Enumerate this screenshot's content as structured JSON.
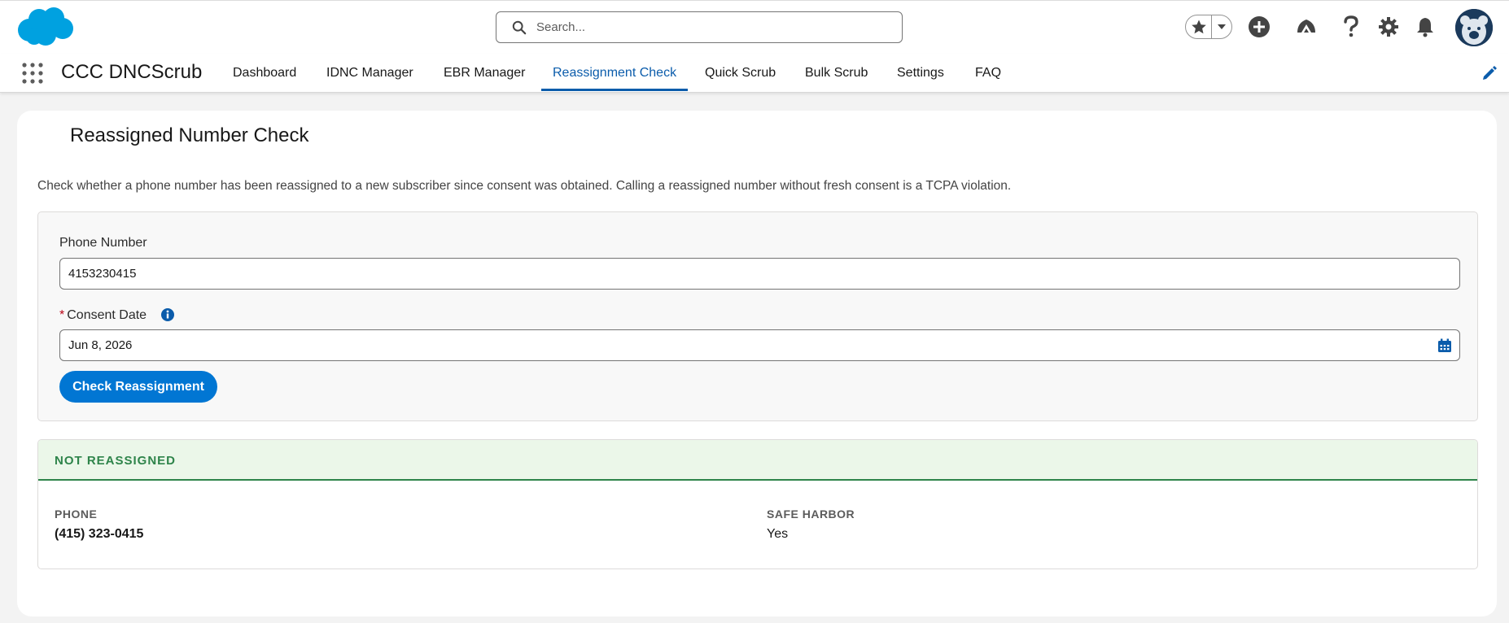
{
  "header": {
    "search_placeholder": "Search..."
  },
  "app": {
    "name": "CCC DNCScrub",
    "tabs": [
      {
        "label": "Dashboard"
      },
      {
        "label": "IDNC Manager"
      },
      {
        "label": "EBR Manager"
      },
      {
        "label": "Reassignment Check"
      },
      {
        "label": "Quick Scrub"
      },
      {
        "label": "Bulk Scrub"
      },
      {
        "label": "Settings"
      },
      {
        "label": "FAQ"
      }
    ],
    "active_tab": "Reassignment Check"
  },
  "page": {
    "title": "Reassigned Number Check",
    "description": "Check whether a phone number has been reassigned to a new subscriber since consent was obtained. Calling a reassigned number without fresh consent is a TCPA violation."
  },
  "form": {
    "phone_label": "Phone Number",
    "phone_value": "4153230415",
    "consent_required_mark": "*",
    "consent_label": "Consent Date",
    "consent_value": "Jun 8, 2026",
    "submit_label": "Check Reassignment"
  },
  "result": {
    "status": "NOT REASSIGNED",
    "phone_label": "PHONE",
    "phone_value": "(415) 323-0415",
    "safe_harbor_label": "SAFE HARBOR",
    "safe_harbor_value": "Yes"
  },
  "colors": {
    "brand": "#00a1e0",
    "accent": "#0176d3",
    "active_tab": "#0b5cab",
    "success": "#2e844a",
    "success_bg": "#ebf7e9"
  },
  "icons": [
    "salesforce-cloud-logo",
    "search-icon",
    "favorites-star-icon",
    "chevron-down-icon",
    "add-icon",
    "trailhead-icon",
    "help-icon",
    "gear-icon",
    "bell-icon",
    "avatar",
    "app-launcher-icon",
    "pencil-icon",
    "info-icon",
    "calendar-icon"
  ]
}
